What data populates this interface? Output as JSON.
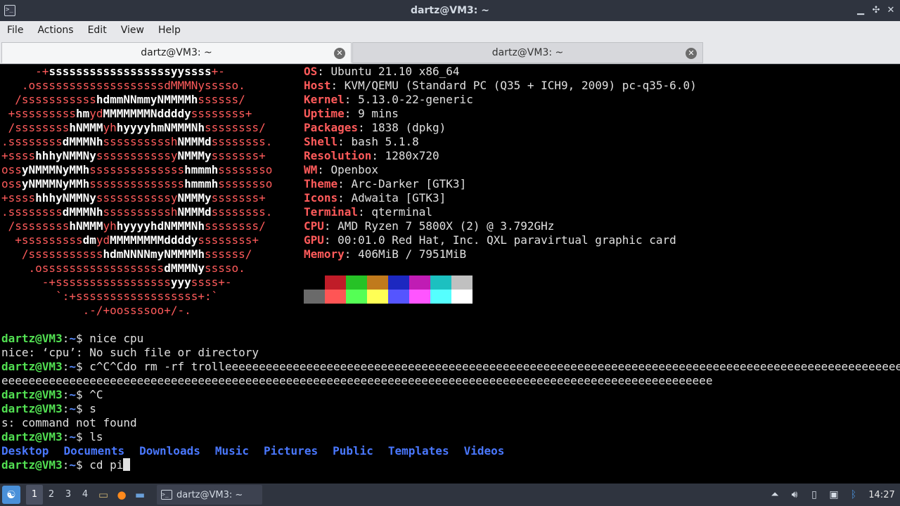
{
  "window": {
    "title": "dartz@VM3: ~",
    "controls": [
      "minimize-icon",
      "maximize-icon",
      "close-icon"
    ]
  },
  "menubar": [
    "File",
    "Actions",
    "Edit",
    "View",
    "Help"
  ],
  "tabs": [
    {
      "label": "dartz@VM3: ~",
      "active": true
    },
    {
      "label": "dartz@VM3: ~",
      "active": false
    }
  ],
  "neofetch": {
    "art": [
      [
        "     -+",
        "ssssssssssssssssssyyssss",
        "+-"
      ],
      [
        "   .osssssssssssssssssssdMMMNysssso."
      ],
      [
        "  /sssssssssss",
        "hdmmNNmmyNMMMMh",
        "ssssss/"
      ],
      [
        " +sssssssss",
        "hm",
        "yd",
        "MMMMMMMNddddy",
        "ssssssss+"
      ],
      [
        " /ssssssss",
        "hNMMM",
        "yh",
        "hyyyyhmNMMMNh",
        "ssssssss/"
      ],
      [
        ".ssssssss",
        "dMMMNh",
        "ssssssssssh",
        "NMMMd",
        "ssssssss."
      ],
      [
        "+ssss",
        "hhhyNMMNy",
        "sssssssssssy",
        "NMMMy",
        "sssssss+"
      ],
      [
        "oss",
        "yNMMMNyMMh",
        "ssssssssssssss",
        "hmmmh",
        "ssssssso"
      ],
      [
        "oss",
        "yNMMMNyMMh",
        "ssssssssssssss",
        "hmmmh",
        "ssssssso"
      ],
      [
        "+ssss",
        "hhhyNMMNy",
        "sssssssssssy",
        "NMMMy",
        "sssssss+"
      ],
      [
        ".ssssssss",
        "dMMMNh",
        "ssssssssssh",
        "NMMMd",
        "ssssssss."
      ],
      [
        " /ssssssss",
        "hNMMM",
        "yh",
        "hyyyyhdNMMMNh",
        "ssssssss/"
      ],
      [
        "  +sssssssss",
        "dm",
        "yd",
        "MMMMMMMMddddy",
        "ssssssss+"
      ],
      [
        "   /sssssssssss",
        "hdmNNNNmyNMMMMh",
        "ssssss/"
      ],
      [
        "    .ossssssssssssssssss",
        "dMMMNy",
        "sssso."
      ],
      [
        "      -+sssssssssssssssss",
        "yyy",
        "ssss+-"
      ],
      [
        "        `:+ssssssssssssssssss+:`"
      ],
      [
        "            .-/+oossssoo+/-."
      ]
    ],
    "info": [
      {
        "key": "OS",
        "value": "Ubuntu 21.10 x86_64"
      },
      {
        "key": "Host",
        "value": "KVM/QEMU (Standard PC (Q35 + ICH9, 2009) pc-q35-6.0)"
      },
      {
        "key": "Kernel",
        "value": "5.13.0-22-generic"
      },
      {
        "key": "Uptime",
        "value": "9 mins"
      },
      {
        "key": "Packages",
        "value": "1838 (dpkg)"
      },
      {
        "key": "Shell",
        "value": "bash 5.1.8"
      },
      {
        "key": "Resolution",
        "value": "1280x720"
      },
      {
        "key": "WM",
        "value": "Openbox"
      },
      {
        "key": "Theme",
        "value": "Arc-Darker [GTK3]"
      },
      {
        "key": "Icons",
        "value": "Adwaita [GTK3]"
      },
      {
        "key": "Terminal",
        "value": "qterminal"
      },
      {
        "key": "CPU",
        "value": "AMD Ryzen 7 5800X (2) @ 3.792GHz"
      },
      {
        "key": "GPU",
        "value": "00:01.0 Red Hat, Inc. QXL paravirtual graphic card"
      },
      {
        "key": "Memory",
        "value": "406MiB / 7951MiB"
      }
    ],
    "palette_top": [
      "#000000",
      "#c01c28",
      "#26c226",
      "#c07a1c",
      "#1c28c0",
      "#c01cb4",
      "#1cc0c0",
      "#c0c0c0"
    ],
    "palette_bottom": [
      "#6a6a6a",
      "#ff5555",
      "#55ff55",
      "#ffff55",
      "#5555ff",
      "#ff55ff",
      "#55ffff",
      "#ffffff"
    ]
  },
  "prompt": {
    "user": "dartz@VM3",
    "sep": ":",
    "path": "~",
    "sign": "$ "
  },
  "session": [
    {
      "type": "cmd",
      "text": "nice cpu"
    },
    {
      "type": "out",
      "text": "nice: ‘cpu’: No such file or directory"
    },
    {
      "type": "cmd",
      "text": "c^C^Cdo rm -rf trolleeeeeeeeeeeeeeeeeeeeeeeeeeeeeeeeeeeeeeeeeeeeeeeeeeeeeeeeeeeeeeeeeeeeeeeeeeeeeeeeeeeeeeeeeeeeeeeeeeeeeeeee"
    },
    {
      "type": "out",
      "text": "eeeeeeeeeeeeeeeeeeeeeeeeeeeeeeeeeeeeeeeeeeeeeeeeeeeeeeeeeeeeeeeeeeeeeeeeeeeeeeeeeeeeeeeeeeeeeeeeeeeeeeeee"
    },
    {
      "type": "cmd",
      "text": "^C"
    },
    {
      "type": "cmd",
      "text": "s"
    },
    {
      "type": "out",
      "text": "s: command not found"
    },
    {
      "type": "cmd",
      "text": "ls"
    },
    {
      "type": "dirs",
      "items": [
        "Desktop",
        "Documents",
        "Downloads",
        "Music",
        "Pictures",
        "Public",
        "Templates",
        "Videos"
      ]
    },
    {
      "type": "cmd",
      "text": "cd pi",
      "cursor": true
    }
  ],
  "taskbar": {
    "workspaces": [
      "1",
      "2",
      "3",
      "4"
    ],
    "active_workspace": "1",
    "task_label": "dartz@VM3: ~",
    "clock": "14:27"
  }
}
